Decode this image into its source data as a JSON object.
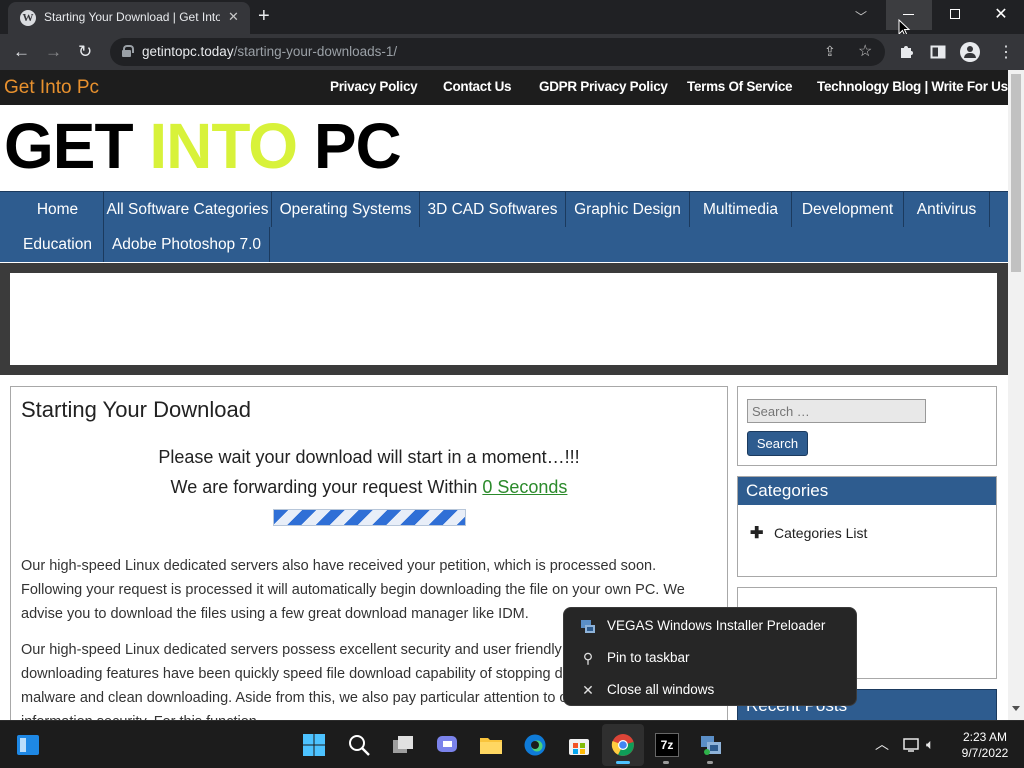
{
  "browser": {
    "tab_title": "Starting Your Download | Get Into PC",
    "url_domain": "getintopc.today",
    "url_path": "/starting-your-downloads-1/",
    "window_controls": [
      "minimize-icon",
      "restore-icon",
      "close-icon"
    ]
  },
  "site": {
    "name": "Get Into Pc",
    "top_links": [
      "Privacy Policy",
      "Contact Us",
      "GDPR Privacy Policy",
      "Terms Of Service",
      "Technology Blog | Write For Us"
    ],
    "logo": {
      "word1": "GET",
      "word2": "INTO",
      "word3": "PC"
    },
    "nav": [
      "Home",
      "All Software Categories",
      "Operating Systems",
      "3D CAD Softwares",
      "Graphic Design",
      "Multimedia",
      "Development",
      "Antivirus",
      "Education",
      "Adobe Photoshop 7.0"
    ]
  },
  "content": {
    "title": "Starting Your Download",
    "wait_text": "Please wait your download will start in a moment…!!!",
    "forward_text": "We are forwarding your request Within",
    "countdown": "0 Seconds",
    "para1": "Our high-speed Linux dedicated servers also have received your petition, which is processed soon. Following your request is processed it will automatically begin downloading the file on your own PC. We advise you to download the files using a few great download manager like IDM.",
    "para2": "Our high-speed Linux dedicated servers possess excellent security and user friendly features. These brilliant downloading features have been quickly speed file download capability of stopping downloading and malware and clean downloading. Aside from this, we also pay particular attention to our users privacy and information security. For this function"
  },
  "sidebar": {
    "search_placeholder": "Search …",
    "search_button": "Search",
    "categories_header": "Categories",
    "categories_item": "Categories List",
    "recent_header": "Recent Posts"
  },
  "jumplist": {
    "items": [
      {
        "label": "VEGAS Windows Installer Preloader",
        "icon": "installer-icon"
      },
      {
        "label": "Pin to taskbar",
        "icon": "pin-icon"
      },
      {
        "label": "Close all windows",
        "icon": "close-icon"
      }
    ]
  },
  "taskbar": {
    "time": "2:23 AM",
    "date": "9/7/2022",
    "apps": [
      "start",
      "search",
      "task-view",
      "teams-chat",
      "file-explorer",
      "edge",
      "store",
      "chrome",
      "7zip",
      "installer"
    ]
  },
  "colors": {
    "nav_blue": "#2e5c8f",
    "site_name_orange": "#e8912e",
    "logo_lime": "#d8f23a",
    "countdown_green": "#2b8a2b"
  }
}
